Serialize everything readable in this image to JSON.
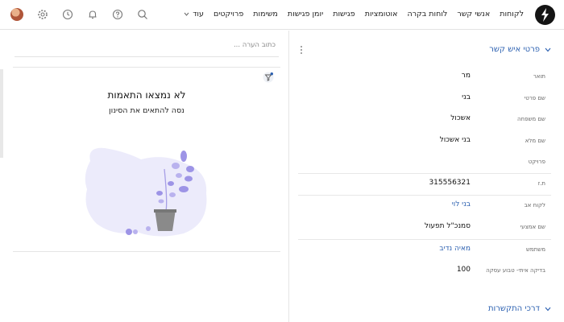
{
  "nav": {
    "items": [
      "לקוחות",
      "אנשי קשר",
      "לוחות בקרה",
      "אוטומציות",
      "פגישות",
      "יומן פגישות",
      "משימות",
      "פרויקטים"
    ],
    "more_label": "עוד"
  },
  "icons": [
    "logo-icon",
    "chevron-down-icon",
    "search-icon",
    "help-icon",
    "bell-icon",
    "clock-icon",
    "gear-icon",
    "avatar"
  ],
  "comment": {
    "placeholder": "כתוב הערה ..."
  },
  "empty_state": {
    "title": "לא נמצאו התאמות",
    "subtitle": "נסה להתאים את הסינון"
  },
  "details": {
    "section_title": "פרטי איש קשר",
    "fields": [
      {
        "label": "תואר",
        "value": "מר"
      },
      {
        "label": "שם פרטי",
        "value": "בני"
      },
      {
        "label": "שם משפחה",
        "value": "אשכול"
      },
      {
        "label": "שם מלא",
        "value": "בני אשכול"
      },
      {
        "label": "פרויקט",
        "value": ""
      },
      {
        "label": "ת.ז",
        "value": "315556321"
      },
      {
        "label": "לקוח אב",
        "value": "בני לוי"
      },
      {
        "label": "שם אמצעי",
        "value": "סמנכ\"ל תפעול"
      },
      {
        "label": "משתמש",
        "value": "מאיה נדיב"
      },
      {
        "label": "בדיקה איתי- טבוע עסקה",
        "value": "100"
      }
    ]
  },
  "contact_section": {
    "title": "דרכי התקשרות"
  },
  "colors": {
    "accent": "#2a5fb0",
    "illustration": "#9d94e6"
  }
}
